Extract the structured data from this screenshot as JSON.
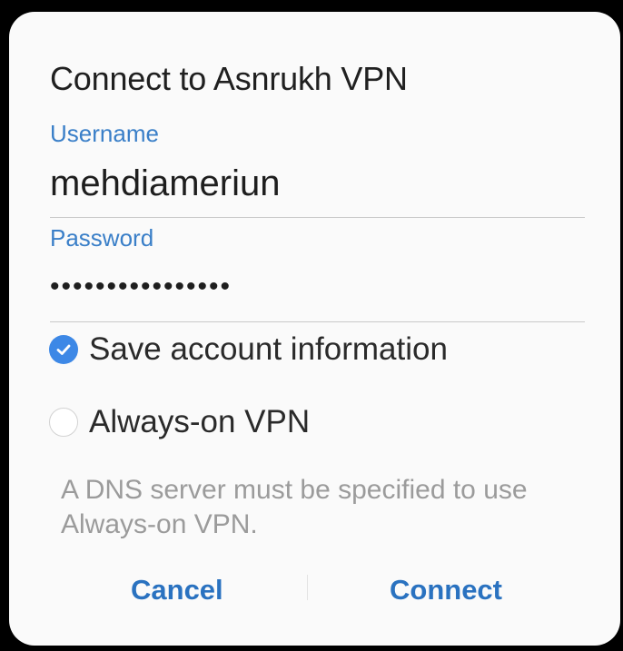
{
  "dialog": {
    "title": "Connect to Asnrukh VPN",
    "username": {
      "label": "Username",
      "value": "mehdiameriun"
    },
    "password": {
      "label": "Password",
      "masked_value": "••••••••••••••••"
    },
    "options": [
      {
        "label": "Save account information",
        "checked": true,
        "icon": "checkmark-circle-icon"
      },
      {
        "label": "Always-on VPN",
        "checked": false,
        "icon": "empty-circle-icon"
      }
    ],
    "note": "A DNS server must be specified to use Always-on VPN.",
    "buttons": {
      "cancel": "Cancel",
      "connect": "Connect"
    }
  },
  "colors": {
    "accent": "#3a7fc8",
    "check_fill": "#3d88e6",
    "button_text": "#2a72c0",
    "note_text": "#9b9b9b",
    "frame": "#000000",
    "dialog_bg": "#fafafa"
  }
}
